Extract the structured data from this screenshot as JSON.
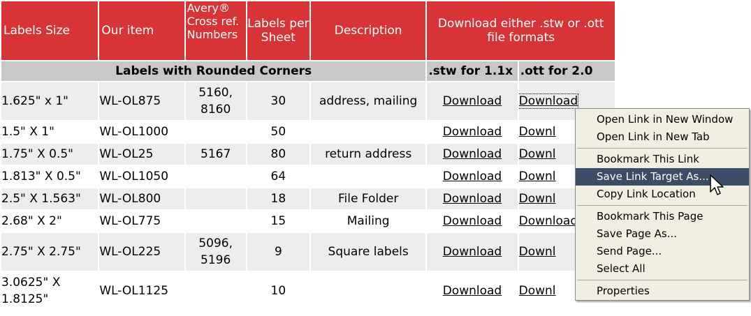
{
  "headers": {
    "size": "Labels Size",
    "item": "Our item",
    "avery": "Avery® Cross ref. Numbers",
    "per_sheet": "Labels per Sheet",
    "description": "Description",
    "download": "Download either .stw or .ott file formats"
  },
  "section": {
    "title": "Labels with Rounded Corners",
    "stw": ".stw for 1.1x",
    "ott": ".ott for 2.0"
  },
  "rows": [
    {
      "size": "1.625\" x 1\"",
      "item": "WL-OL875",
      "avery": "5160, 8160",
      "per_sheet": "30",
      "description": "address, mailing",
      "stw": "Download",
      "ott": "Download"
    },
    {
      "size": "1.5\" X 1\"",
      "item": "WL-OL1000",
      "avery": "",
      "per_sheet": "50",
      "description": "",
      "stw": "Download",
      "ott": "Downl"
    },
    {
      "size": "1.75\" X 0.5\"",
      "item": "WL-OL25",
      "avery": "5167",
      "per_sheet": "80",
      "description": "return address",
      "stw": "Download",
      "ott": "Downl"
    },
    {
      "size": "1.813\" X 0.5\"",
      "item": "WL-OL1050",
      "avery": "",
      "per_sheet": "64",
      "description": "",
      "stw": "Download",
      "ott": "Downl"
    },
    {
      "size": "2.5\" X 1.563\"",
      "item": "WL-OL800",
      "avery": "",
      "per_sheet": "18",
      "description": "File Folder",
      "stw": "Download",
      "ott": "Downl"
    },
    {
      "size": "2.68\" X 2\"",
      "item": "WL-OL775",
      "avery": "",
      "per_sheet": "15",
      "description": "Mailing",
      "stw": "Download",
      "ott": "Download"
    },
    {
      "size": "2.75\" X 2.75\"",
      "item": "WL-OL225",
      "avery": "5096, 5196",
      "per_sheet": "9",
      "description": "Square labels",
      "stw": "Download",
      "ott": "Downl"
    },
    {
      "size": "3.0625\" X 1.8125\"",
      "item": "WL-OL1125",
      "avery": "",
      "per_sheet": "10",
      "description": "",
      "stw": "Download",
      "ott": "Downl"
    }
  ],
  "context_menu": {
    "open_new_window": "Open Link in New Window",
    "open_new_tab": "Open Link in New Tab",
    "bookmark_link": "Bookmark This Link",
    "save_link_as": "Save Link Target As...",
    "copy_link": "Copy Link Location",
    "bookmark_page": "Bookmark This Page",
    "save_page_as": "Save Page As...",
    "send_page": "Send Page...",
    "select_all": "Select All",
    "properties": "Properties",
    "selected_item": "save_link_as"
  },
  "colors": {
    "header_red": "#d83438",
    "section_gray": "#c8c8c8",
    "menu_bg": "#f1efe2",
    "menu_highlight": "#3d4c66"
  },
  "icons": {
    "cursor": "arrow-pointer-icon"
  }
}
